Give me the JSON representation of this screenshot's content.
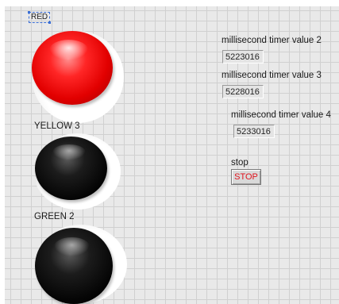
{
  "leds": {
    "red": {
      "label": "RED",
      "state": "on",
      "color": "#f01010"
    },
    "yellow": {
      "label": "YELLOW 3",
      "state": "off",
      "color": "#000000"
    },
    "green": {
      "label": "GREEN 2",
      "state": "off",
      "color": "#000000"
    }
  },
  "timers": [
    {
      "label": "millisecond timer value 2",
      "value": "5223016"
    },
    {
      "label": "millisecond timer value 3",
      "value": "5228016"
    },
    {
      "label": "millisecond timer value 4",
      "value": "5233016"
    }
  ],
  "stop": {
    "label": "stop",
    "button_text": "STOP",
    "text_color": "#e0141e"
  }
}
